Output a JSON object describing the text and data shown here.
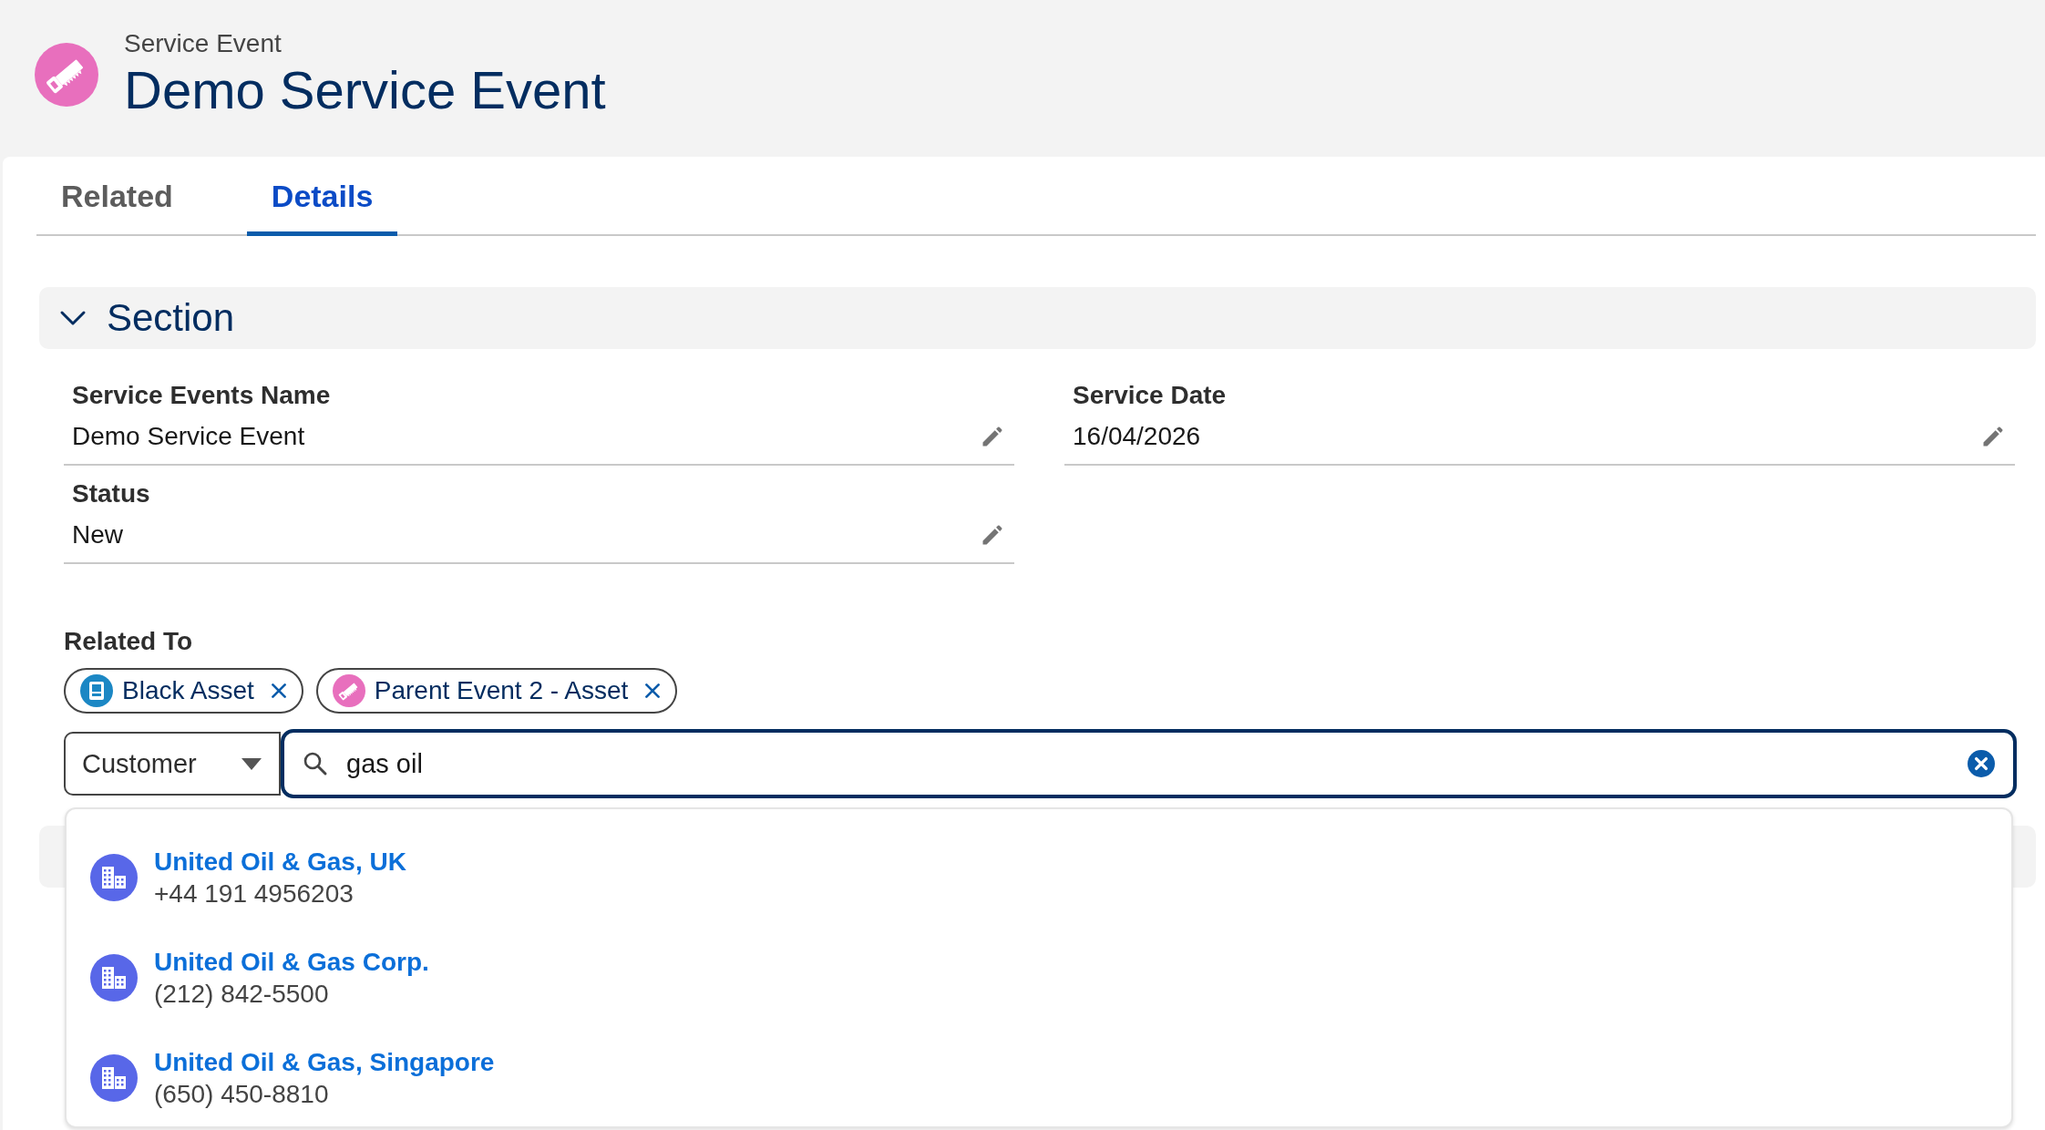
{
  "header": {
    "object_type": "Service Event",
    "title": "Demo Service Event"
  },
  "tabs": [
    {
      "label": "Related",
      "selected": false
    },
    {
      "label": "Details",
      "selected": true
    }
  ],
  "section": {
    "title": "Section",
    "expanded": true,
    "fields": [
      {
        "label": "Service Events Name",
        "value": "Demo Service Event"
      },
      {
        "label": "Service Date",
        "value": "16/04/2026"
      },
      {
        "label": "Status",
        "value": "New"
      }
    ]
  },
  "related_to": {
    "label": "Related To",
    "pills": [
      {
        "label": "Black Asset",
        "kind": "asset"
      },
      {
        "label": "Parent Event 2 - Asset",
        "kind": "event"
      }
    ],
    "object_picker": {
      "value": "Customer"
    },
    "search": {
      "value": "gas oil"
    },
    "results": [
      {
        "name": "United Oil & Gas, UK",
        "phone": "+44 191 4956203"
      },
      {
        "name": "United Oil & Gas Corp.",
        "phone": "(212) 842-5500"
      },
      {
        "name": "United Oil & Gas, Singapore",
        "phone": "(650) 450-8810"
      }
    ]
  }
}
